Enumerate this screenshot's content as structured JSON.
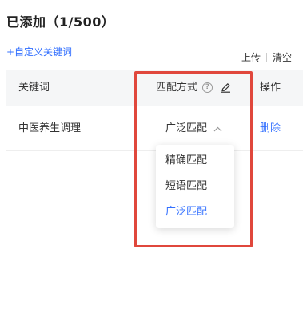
{
  "header": {
    "title": "已添加（1/500）",
    "add_link": "+自定义关键词"
  },
  "toolbar": {
    "upload": "上传",
    "clear": "清空"
  },
  "table": {
    "columns": {
      "keyword": "关键词",
      "match": "匹配方式",
      "op": "操作"
    },
    "rows": [
      {
        "keyword": "中医养生调理",
        "match": "广泛匹配",
        "action": "删除"
      }
    ]
  },
  "dropdown": {
    "options": [
      {
        "label": "精确匹配",
        "selected": false
      },
      {
        "label": "短语匹配",
        "selected": false
      },
      {
        "label": "广泛匹配",
        "selected": true
      }
    ]
  },
  "icons": {
    "help": "question-circle-icon",
    "edit": "pencil-icon",
    "chevron": "chevron-up-icon"
  },
  "colors": {
    "accent": "#3370ff",
    "highlight": "#e0473c"
  }
}
